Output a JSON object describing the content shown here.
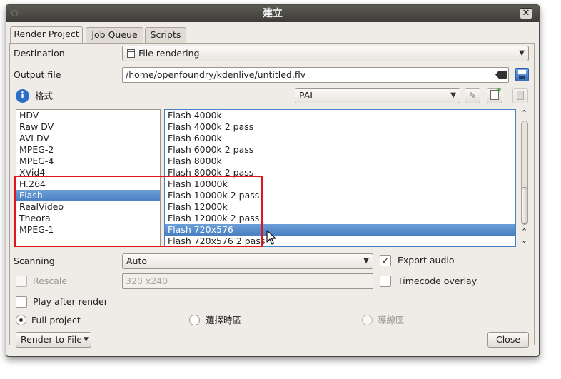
{
  "window": {
    "title": "建立",
    "close_glyph": "✕"
  },
  "tabs": [
    {
      "label": "Render Project"
    },
    {
      "label": "Job Queue"
    },
    {
      "label": "Scripts"
    }
  ],
  "destination": {
    "label": "Destination",
    "value": "File rendering",
    "icon": "film-icon"
  },
  "output_file": {
    "label": "Output file",
    "value": "/home/openfoundry/kdenlive/untitled.flv"
  },
  "format": {
    "label": "格式",
    "profile": "PAL"
  },
  "format_list": {
    "items": [
      "HDV",
      "Raw DV",
      "AVI DV",
      "MPEG-2",
      "MPEG-4",
      "XVid4",
      "H.264",
      "Flash",
      "RealVideo",
      "Theora",
      "MPEG-1"
    ],
    "selected": "Flash"
  },
  "preset_list": {
    "items": [
      "Flash 4000k",
      "Flash 4000k 2 pass",
      "Flash 6000k",
      "Flash 6000k 2 pass",
      "Flash 8000k",
      "Flash 8000k 2 pass",
      "Flash 10000k",
      "Flash 10000k 2 pass",
      "Flash 12000k",
      "Flash 12000k 2 pass",
      "Flash 720x576",
      "Flash 720x576 2 pass"
    ],
    "selected": "Flash 720x576"
  },
  "scanning": {
    "label": "Scanning",
    "value": "Auto"
  },
  "export_audio": {
    "label": "Export audio",
    "checked": true,
    "mark": "✓"
  },
  "rescale": {
    "label": "Rescale",
    "value": "320 x240"
  },
  "timecode_overlay": {
    "label": "Timecode overlay"
  },
  "play_after_render": {
    "label": "Play after render"
  },
  "range": {
    "full_project": "Full project",
    "selected_zone": "選擇時區",
    "guide_zone": "導線區"
  },
  "buttons": {
    "render_to_file": "Render to File",
    "close": "Close"
  },
  "colors": {
    "selection": "#4a7fc1",
    "highlight_box": "#e0161b"
  }
}
